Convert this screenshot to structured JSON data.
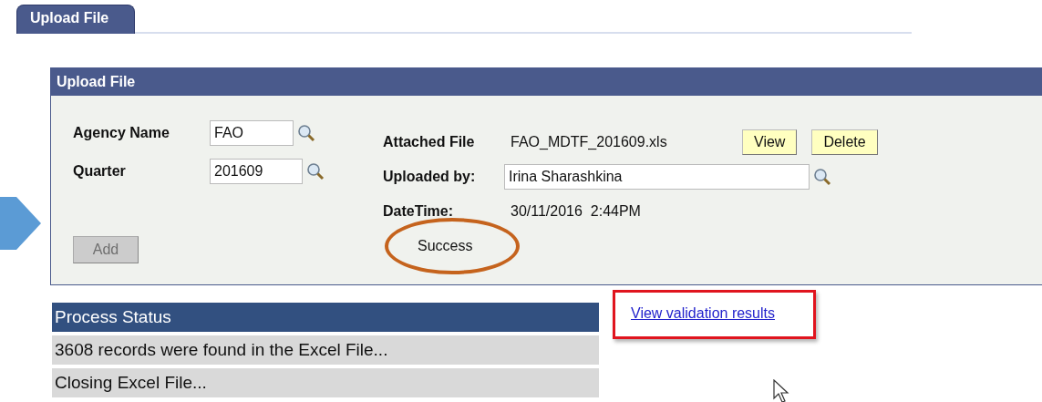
{
  "tab": {
    "label": "Upload File",
    "selected": true
  },
  "panel": {
    "title": "Upload File",
    "fields": [
      {
        "label": "Agency Name",
        "value": "FAO"
      },
      {
        "label": "Quarter",
        "value": "201609"
      }
    ],
    "add_button": {
      "label": "Add",
      "disabled": true
    },
    "attached_file": {
      "label": "Attached File",
      "value": "FAO_MDTF_201609.xls"
    },
    "buttons": [
      "View",
      "Delete"
    ],
    "uploaded_by": {
      "label": "Uploaded by:",
      "value": "Irina Sharashkina"
    },
    "datetime": {
      "label": "DateTime:",
      "value": "30/11/2016  2:44PM"
    },
    "status": "Success"
  },
  "process_status": {
    "title": "Process Status",
    "rows": [
      "3608 records were found in the Excel File...",
      "Closing Excel File..."
    ]
  },
  "link": "View validation results"
}
